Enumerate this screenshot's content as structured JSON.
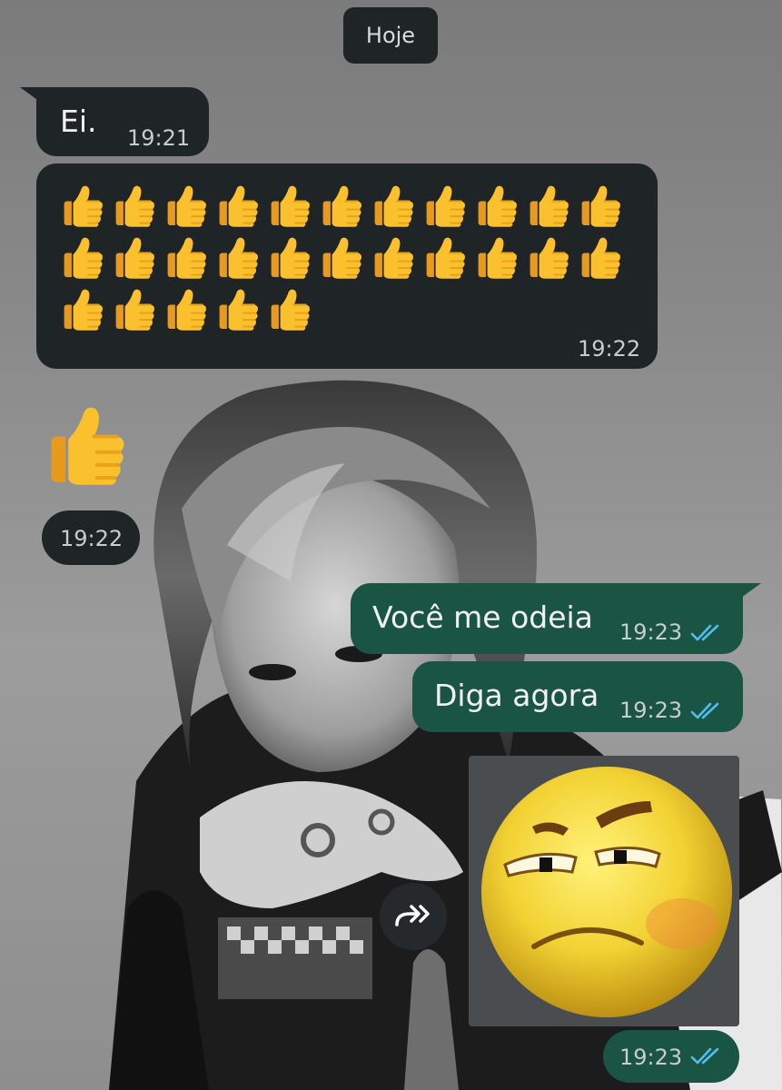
{
  "date_pill": "Hoje",
  "messages": {
    "m1": {
      "text": "Ei.",
      "time": "19:21"
    },
    "m2": {
      "emoji_count": 27,
      "time": "19:22"
    },
    "m3": {
      "time": "19:22"
    },
    "m4": {
      "text": "Você me odeia",
      "time": "19:23"
    },
    "m5": {
      "text": "Diga agora",
      "time": "19:23"
    },
    "m6": {
      "time": "19:23"
    }
  },
  "colors": {
    "incoming_bubble": "#1f2426",
    "outgoing_bubble": "#1a5443",
    "read_ticks": "#53bdeb",
    "time_text": "#c9cccd"
  },
  "icons": {
    "thumbs": "thumbs-up-emoji",
    "sticker": "annoyed-face-sticker",
    "forward": "forward-arrow-icon",
    "ticks": "double-check-icon"
  }
}
